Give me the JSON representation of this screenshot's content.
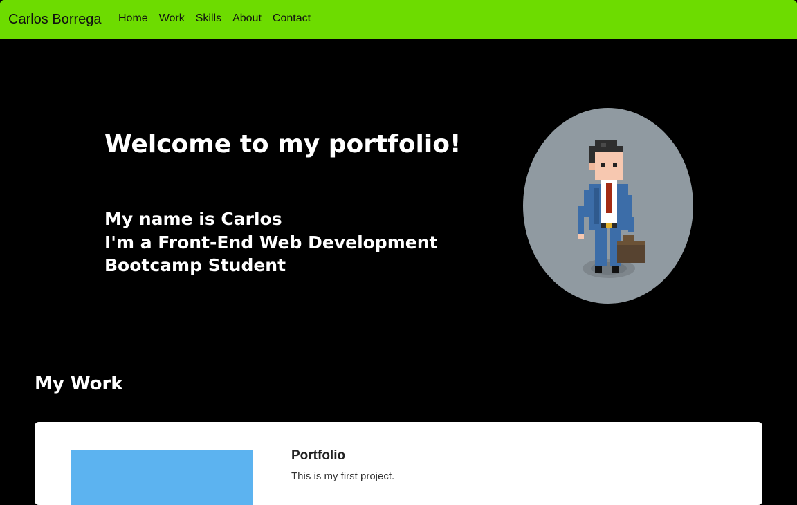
{
  "colors": {
    "navbar_bg": "#6ddc00",
    "page_bg": "#000000",
    "card_bg": "#ffffff",
    "card_image": "#5cb3f0",
    "avatar_bg": "#909aa1"
  },
  "navbar": {
    "brand": "Carlos Borrega",
    "links": [
      "Home",
      "Work",
      "Skills",
      "About",
      "Contact"
    ]
  },
  "hero": {
    "title": "Welcome to my portfolio!",
    "lines": [
      "My name is Carlos",
      "I'm a Front-End Web Development",
      "Bootcamp Student"
    ],
    "avatar_icon": "pixel-businessman-avatar"
  },
  "work": {
    "title": "My Work",
    "projects": [
      {
        "title": "Portfolio",
        "description": "This is my first project."
      }
    ]
  }
}
